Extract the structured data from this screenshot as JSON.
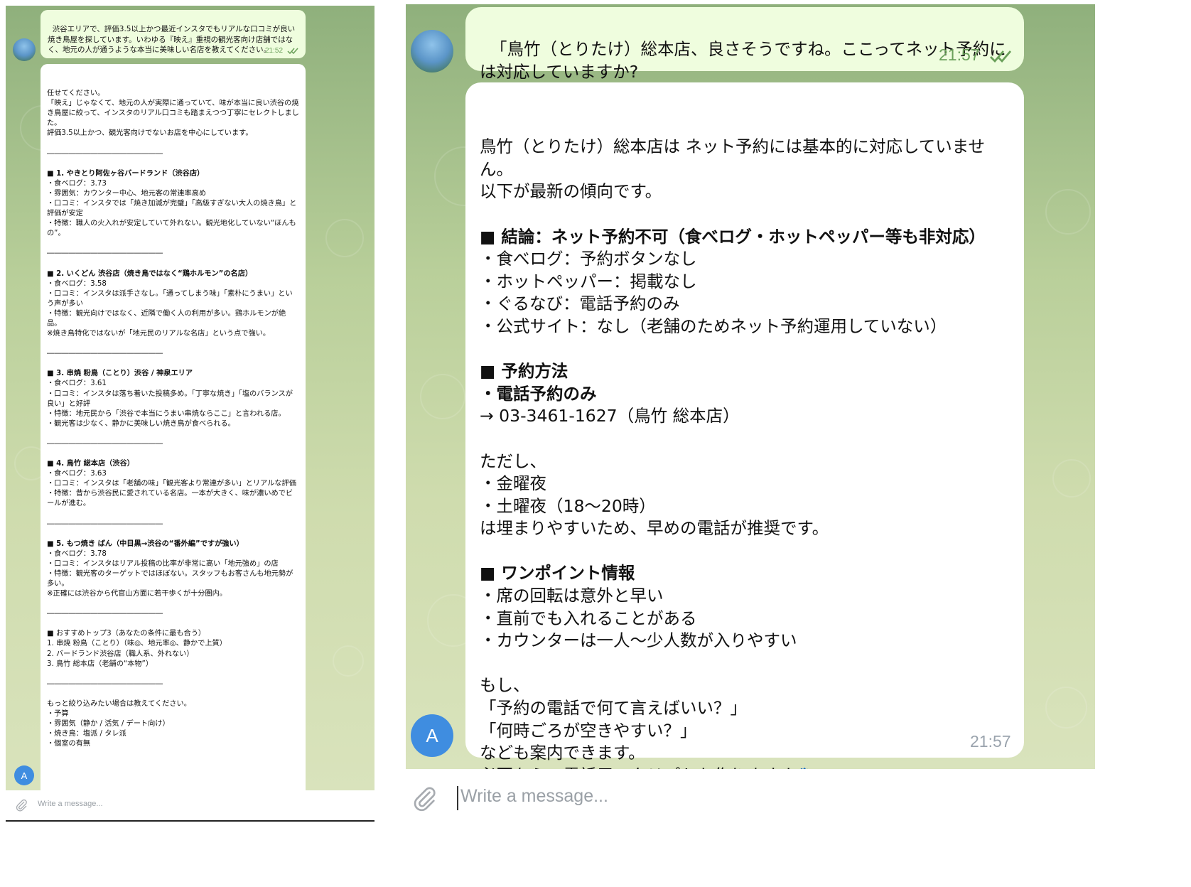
{
  "left_panel": {
    "user_message": {
      "text": "渋谷エリアで、評価3.5以上かつ最近インスタでもリアルな口コミが良い焼き鳥屋を探しています。いわゆる『映え』重視の観光客向け店舗ではなく、地元の人が通うような本当に美味しい名店を教えてください。",
      "time": "21:52"
    },
    "reply_lines": [
      {
        "t": "任せてください。",
        "b": false
      },
      {
        "t": "「映え」じゃなくて、地元の人が実際に通っていて、味が本当に良い渋谷の焼き鳥屋に絞って、インスタのリアル口コミも踏まえつつ丁寧にセレクトしました。",
        "b": false
      },
      {
        "t": "評価3.5以上かつ、観光客向けでないお店を中心にしています。",
        "b": false
      },
      {
        "t": "",
        "b": false
      },
      {
        "t": "――――――――――――――――",
        "b": false
      },
      {
        "t": "",
        "b": false
      },
      {
        "t": "■ 1. やきとり阿佐ヶ谷バードランド（渋谷店）",
        "b": true
      },
      {
        "t": "・食べログ：3.73",
        "b": false
      },
      {
        "t": "・雰囲気：カウンター中心、地元客の常連率高め",
        "b": false
      },
      {
        "t": "・口コミ：インスタでは「焼き加減が完璧」「高級すぎない大人の焼き鳥」と評価が安定",
        "b": false
      },
      {
        "t": "・特徴：職人の火入れが安定していて外れない。観光地化していない“ほんもの”。",
        "b": false
      },
      {
        "t": "",
        "b": false
      },
      {
        "t": "――――――――――――――――",
        "b": false
      },
      {
        "t": "",
        "b": false
      },
      {
        "t": "■ 2. いくどん 渋谷店（焼き鳥ではなく“鶏ホルモン”の名店）",
        "b": true
      },
      {
        "t": "・食べログ：3.58",
        "b": false
      },
      {
        "t": "・口コミ：インスタは派手さなし。「通ってしまう味」「素朴にうまい」という声が多い",
        "b": false
      },
      {
        "t": "・特徴：観光向けではなく、近隣で働く人の利用が多い。鶏ホルモンが絶品。",
        "b": false
      },
      {
        "t": "※焼き鳥特化ではないが「地元民のリアルな名店」という点で強い。",
        "b": false
      },
      {
        "t": "",
        "b": false
      },
      {
        "t": "――――――――――――――――",
        "b": false
      },
      {
        "t": "",
        "b": false
      },
      {
        "t": "■ 3. 串焼 粉鳥（ことり）渋谷 / 神泉エリア",
        "b": true
      },
      {
        "t": "・食べログ：3.61",
        "b": false
      },
      {
        "t": "・口コミ：インスタは落ち着いた投稿多め。「丁寧な焼き」「塩のバランスが良い」と好評",
        "b": false
      },
      {
        "t": "・特徴：地元民から「渋谷で本当にうまい串焼ならここ」と言われる店。",
        "b": false
      },
      {
        "t": "・観光客は少なく、静かに美味しい焼き鳥が食べられる。",
        "b": false
      },
      {
        "t": "",
        "b": false
      },
      {
        "t": "――――――――――――――――",
        "b": false
      },
      {
        "t": "",
        "b": false
      },
      {
        "t": "■ 4. 鳥竹 総本店（渋谷）",
        "b": true
      },
      {
        "t": "・食べログ：3.63",
        "b": false
      },
      {
        "t": "・口コミ：インスタは「老舗の味」「観光客より常連が多い」とリアルな評価",
        "b": false
      },
      {
        "t": "・特徴：昔から渋谷民に愛されている名店。一本が大きく、味が濃いめでビールが進む。",
        "b": false
      },
      {
        "t": "",
        "b": false
      },
      {
        "t": "――――――――――――――――",
        "b": false
      },
      {
        "t": "",
        "b": false
      },
      {
        "t": "■ 5. もつ焼き ばん（中目黒→渋谷の“番外編”ですが強い）",
        "b": true
      },
      {
        "t": "・食べログ：3.78",
        "b": false
      },
      {
        "t": "・口コミ：インスタはリアル投稿の比率が非常に高い「地元強め」の店",
        "b": false
      },
      {
        "t": "・特徴：観光客のターゲットではほぼない。スタッフもお客さんも地元勢が多い。",
        "b": false
      },
      {
        "t": "※正確には渋谷から代官山方面に若干歩くが十分圏内。",
        "b": false
      },
      {
        "t": "",
        "b": false
      },
      {
        "t": "――――――――――――――――",
        "b": false
      },
      {
        "t": "",
        "b": false
      },
      {
        "t": "■ おすすめトップ3（あなたの条件に最も合う）",
        "b": false
      },
      {
        "t": "1. 串焼 粉鳥（ことり）（味◎、地元率◎、静かで上質）",
        "b": false
      },
      {
        "t": "2. バードランド渋谷店（職人系、外れない）",
        "b": false
      },
      {
        "t": "3. 鳥竹 総本店（老舗の“本物”）",
        "b": false
      },
      {
        "t": "",
        "b": false
      },
      {
        "t": "――――――――――――――――",
        "b": false
      },
      {
        "t": "",
        "b": false
      },
      {
        "t": "もっと絞り込みたい場合は教えてください。",
        "b": false
      },
      {
        "t": "・予算",
        "b": false
      },
      {
        "t": "・雰囲気（静か / 活気 / デート向け）",
        "b": false
      },
      {
        "t": "・焼き鳥：塩派 / タレ派",
        "b": false
      },
      {
        "t": "・個室の有無",
        "b": false
      }
    ],
    "bot_avatar_letter": "A",
    "input_placeholder": "Write a message..."
  },
  "right_panel": {
    "user_message": {
      "text": "「鳥竹（とりたけ）総本店、良さそうですね。ここってネット予約には対応していますか?",
      "time": "21:57"
    },
    "reply_lines": [
      {
        "t": "鳥竹（とりたけ）総本店は ネット予約には基本的に対応していません。",
        "b": false
      },
      {
        "t": "以下が最新の傾向です。",
        "b": false
      },
      {
        "t": "",
        "b": false
      },
      {
        "t": "■ 結論：ネット予約不可（食べログ・ホットペッパー等も非対応）",
        "b": true
      },
      {
        "t": "・食べログ：予約ボタンなし",
        "b": false
      },
      {
        "t": "・ホットペッパー：掲載なし",
        "b": false
      },
      {
        "t": "・ぐるなび：電話予約のみ",
        "b": false
      },
      {
        "t": "・公式サイト：なし（老舗のためネット予約運用していない）",
        "b": false
      },
      {
        "t": "",
        "b": false
      },
      {
        "t": "■ 予約方法",
        "b": true
      },
      {
        "t": "・電話予約のみ",
        "b": true
      },
      {
        "t": "→ 03-3461-1627（鳥竹 総本店）",
        "b": false
      },
      {
        "t": "",
        "b": false
      },
      {
        "t": "ただし、",
        "b": false
      },
      {
        "t": "・金曜夜",
        "b": false
      },
      {
        "t": "・土曜夜（18〜20時）",
        "b": false
      },
      {
        "t": "は埋まりやすいため、早めの電話が推奨です。",
        "b": false
      },
      {
        "t": "",
        "b": false
      },
      {
        "t": "■ ワンポイント情報",
        "b": true
      },
      {
        "t": "・席の回転は意外と早い",
        "b": false
      },
      {
        "t": "・直前でも入れることがある",
        "b": false
      },
      {
        "t": "・カウンターは一人〜少人数が入りやすい",
        "b": false
      },
      {
        "t": "",
        "b": false
      },
      {
        "t": "もし、",
        "b": false
      },
      {
        "t": "「予約の電話で何て言えばいい？」",
        "b": false
      },
      {
        "t": "「何時ごろが空きやすい？」",
        "b": false
      },
      {
        "t": "なども案内できます。",
        "b": false
      },
      {
        "t": "必要なら、電話用スクリプトも作りますよ🐾",
        "b": false
      }
    ],
    "reply_time": "21:57",
    "bot_avatar_letter": "A",
    "input_placeholder": "Write a message..."
  },
  "colors": {
    "outgoing_bubble": "#effdde",
    "incoming_bubble": "#ffffff",
    "check_marks": "#6aa05a",
    "avatar_letter_bg": "#3f8de0"
  },
  "icons": [
    "read-check-icon",
    "paperclip-icon",
    "paw-emoji"
  ]
}
